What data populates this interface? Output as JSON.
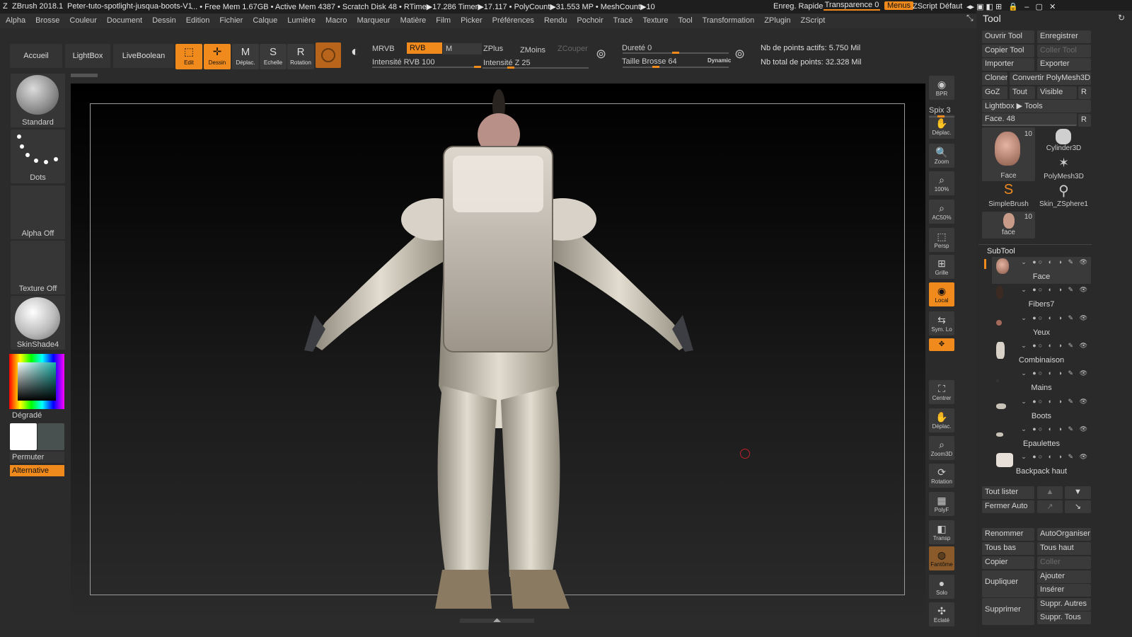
{
  "titlebar": {
    "app": "ZBrush 2018.1",
    "file": "Peter-tuto-spotlight-jusqua-boots-V1",
    "stats": "... • Free Mem 1.67GB • Active Mem 4387 • Scratch Disk 48 •  RTime▶17.286 Timer▶17.117 • PolyCount▶31.553 MP  • MeshCount▶10",
    "quicksave": "Enreg. Rapide",
    "transparency": "Transparence 0",
    "menus": "Menus",
    "zscript_default": "ZScript Défaut"
  },
  "menubar": [
    "Alpha",
    "Brosse",
    "Couleur",
    "Document",
    "Dessin",
    "Edition",
    "Fichier",
    "Calque",
    "Lumière",
    "Macro",
    "Marqueur",
    "Matière",
    "Film",
    "Picker",
    "Préférences",
    "Rendu",
    "Pochoir",
    "Tracé",
    "Texture",
    "Tool",
    "Transformation",
    "ZPlugin",
    "ZScript"
  ],
  "shelf": {
    "tabs": [
      "Accueil",
      "LightBox",
      "LiveBoolean"
    ],
    "tools": [
      {
        "label": "Edit",
        "icon": "edit-icon",
        "active": true
      },
      {
        "label": "Dessin",
        "icon": "draw-icon",
        "active": true
      },
      {
        "label": "Déplac.",
        "icon": "move-icon",
        "active": false
      },
      {
        "label": "Echelle",
        "icon": "scale-icon",
        "active": false
      },
      {
        "label": "Rotation",
        "icon": "rotate-icon",
        "active": false
      }
    ],
    "mrvb": "MRVB",
    "rvb": "RVB",
    "m": "M",
    "intensity_rvb": "Intensité RVB 100",
    "intensity_rvb_level": 1.0,
    "zplus": "ZPlus",
    "zmoins": "ZMoins",
    "zcouper": "ZCouper",
    "intensity_z": "Intensité Z 25",
    "intensity_z_level": 0.25,
    "hardness": "Dureté 0",
    "hardness_level": 0.5,
    "brush_size": "Taille Brosse 64",
    "brush_size_level": 0.3,
    "dynamic": "Dynamic",
    "active_points": "Nb de points actifs: 5.750 Mil",
    "total_points": "Nb total de points: 32.328 Mil"
  },
  "left": {
    "brush": "Standard",
    "stroke": "Dots",
    "alpha": "Alpha Off",
    "texture": "Texture Off",
    "material": "SkinShade4",
    "gradient": "Dégradé",
    "swap": "Permuter",
    "alternate": "Alternative"
  },
  "right_toolbar": [
    {
      "label": "BPR",
      "icon": "bpr-icon"
    },
    {
      "label": "Spix 3",
      "icon": "spix-icon"
    },
    {
      "label": "Déplac.",
      "icon": "move-hand-icon"
    },
    {
      "label": "Zoom",
      "icon": "zoom-icon"
    },
    {
      "label": "100%",
      "icon": "actual-size-icon"
    },
    {
      "label": "AC50%",
      "icon": "half-size-icon"
    },
    {
      "label": "Persp",
      "icon": "persp-icon"
    },
    {
      "label": "Grille",
      "icon": "floor-icon"
    },
    {
      "label": "Local",
      "icon": "local-icon"
    },
    {
      "label": "Sym. Lo",
      "icon": "sym-icon"
    },
    {
      "label": "XYZ",
      "icon": "xyz-icon"
    },
    {
      "label": "Centrer",
      "icon": "frame-icon"
    },
    {
      "label": "Déplac.",
      "icon": "move-hand-icon"
    },
    {
      "label": "Zoom3D",
      "icon": "zoom3d-icon"
    },
    {
      "label": "Rotation",
      "icon": "rotate3d-icon"
    },
    {
      "label": "PolyF",
      "icon": "polyframe-icon"
    },
    {
      "label": "Transp",
      "icon": "transp-icon"
    },
    {
      "label": "Fantôme",
      "icon": "ghost-icon"
    },
    {
      "label": "Solo",
      "icon": "solo-icon"
    },
    {
      "label": "Eclaté",
      "icon": "explode-icon"
    }
  ],
  "tool_panel": {
    "title": "Tool",
    "buttons": [
      [
        "Ouvrir Tool",
        "Enregistrer"
      ],
      [
        "Copier Tool",
        "Coller Tool"
      ],
      [
        "Importer",
        "Exporter"
      ],
      [
        "Cloner",
        "Convertir PolyMesh3D"
      ],
      [
        "GoZ",
        "Tout",
        "Visible",
        "R"
      ]
    ],
    "lightbox_tools": "Lightbox ▶ Tools",
    "face_slider": "Face. 48",
    "r": "R",
    "thumbs": [
      {
        "label": "Face",
        "badge": "10"
      },
      {
        "label": "Cylinder3D",
        "badge": ""
      },
      {
        "label": "PolyMesh3D",
        "badge": ""
      },
      {
        "label": "SimpleBrush",
        "badge": ""
      },
      {
        "label": "Skin_ZSphere1",
        "badge": ""
      },
      {
        "label": "face",
        "badge": "10"
      }
    ],
    "subtool_title": "SubTool",
    "subtools": [
      "Face",
      "Fibers7",
      "Yeux",
      "Combinaison",
      "Mains",
      "Boots",
      "Epaulettes",
      "Backpack haut"
    ],
    "list_all": "Tout lister",
    "auto_close": "Fermer Auto",
    "rename": "Renommer",
    "auto_organize": "AutoOrganiser",
    "all_low": "Tous bas",
    "all_high": "Tous haut",
    "copy": "Copier",
    "paste": "Coller",
    "duplicate": "Dupliquer",
    "add": "Ajouter",
    "insert": "Insérer",
    "delete": "Supprimer",
    "del_others": "Suppr. Autres",
    "del_all": "Suppr. Tous"
  },
  "colors": {
    "accent": "#f08a1c",
    "panel": "#2b2b2b",
    "button": "#3a3a3a"
  }
}
